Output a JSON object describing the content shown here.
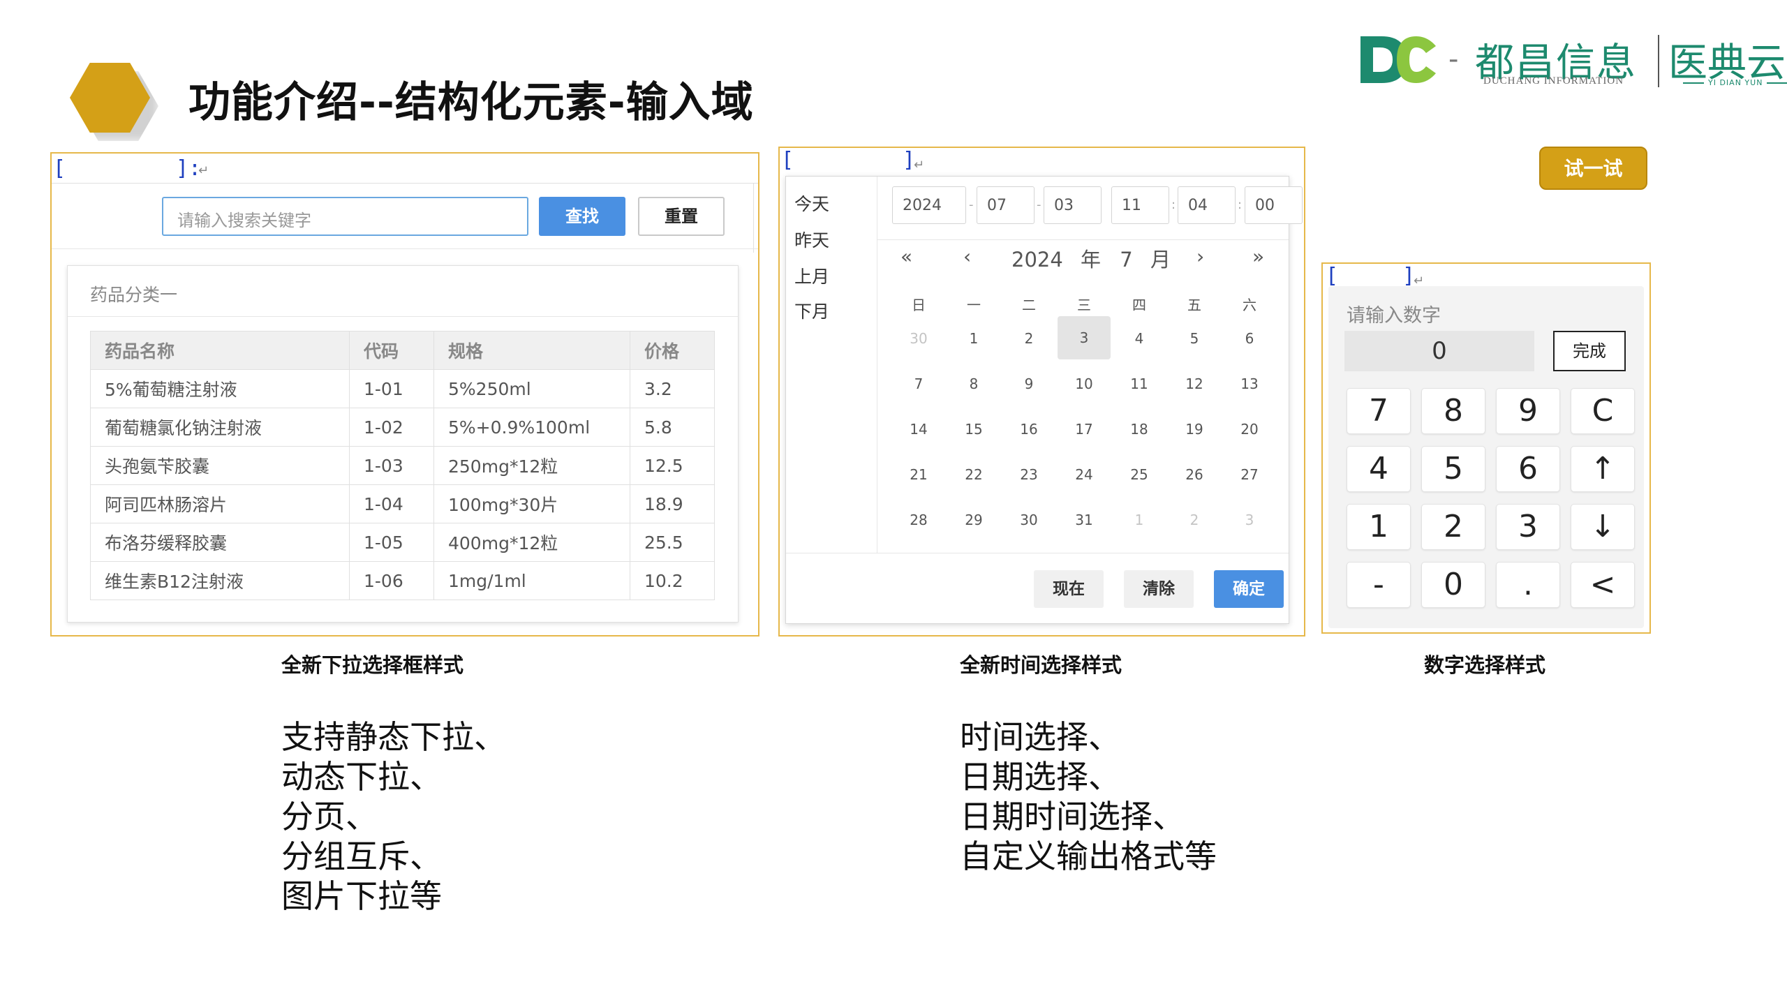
{
  "header": {
    "title": "功能介绍--结构化元素-输入域"
  },
  "logo": {
    "cn": "都昌信息",
    "en": "DUCHANG INFORMATION",
    "cn2": "医典云",
    "en2": "YI DIAN YUN",
    "color": "#1d8a6e"
  },
  "try_button": {
    "label": "试一试",
    "color": "#d4a017"
  },
  "dropdown": {
    "field_open": "[",
    "field_close": "]:",
    "search_placeholder": "请输入搜索关键字",
    "find_label": "查找",
    "reset_label": "重置",
    "category_title": "药品分类一",
    "columns": [
      "药品名称",
      "代码",
      "规格",
      "价格"
    ],
    "rows": [
      [
        "5%葡萄糖注射液",
        "1-01",
        "5%250ml",
        "3.2"
      ],
      [
        "葡萄糖氯化钠注射液",
        "1-02",
        "5%+0.9%100ml",
        "5.8"
      ],
      [
        "头孢氨苄胶囊",
        "1-03",
        "250mg*12粒",
        "12.5"
      ],
      [
        "阿司匹林肠溶片",
        "1-04",
        "100mg*30片",
        "18.9"
      ],
      [
        "布洛芬缓释胶囊",
        "1-05",
        "400mg*12粒",
        "25.5"
      ],
      [
        "维生素B12注射液",
        "1-06",
        "1mg/1ml",
        "10.2"
      ]
    ]
  },
  "datepicker": {
    "field_open": "[",
    "field_close": "]",
    "shortcuts": [
      "今天",
      "昨天",
      "上月",
      "下月"
    ],
    "time_fields": [
      "2024",
      "07",
      "03",
      "11",
      "04",
      "00"
    ],
    "time_separators": [
      "-",
      "-",
      ":",
      ":"
    ],
    "nav": {
      "prev_year": "«",
      "prev_month": "‹",
      "next_month": "›",
      "next_year": "»"
    },
    "year": "2024",
    "year_label": "年",
    "month": "7",
    "month_label": "月",
    "weekdays": [
      "日",
      "一",
      "二",
      "三",
      "四",
      "五",
      "六"
    ],
    "days": [
      [
        {
          "d": "30",
          "m": true
        },
        {
          "d": "1"
        },
        {
          "d": "2"
        },
        {
          "d": "3",
          "s": true
        },
        {
          "d": "4"
        },
        {
          "d": "5"
        },
        {
          "d": "6"
        }
      ],
      [
        {
          "d": "7"
        },
        {
          "d": "8"
        },
        {
          "d": "9"
        },
        {
          "d": "10"
        },
        {
          "d": "11"
        },
        {
          "d": "12"
        },
        {
          "d": "13"
        }
      ],
      [
        {
          "d": "14"
        },
        {
          "d": "15"
        },
        {
          "d": "16"
        },
        {
          "d": "17"
        },
        {
          "d": "18"
        },
        {
          "d": "19"
        },
        {
          "d": "20"
        }
      ],
      [
        {
          "d": "21"
        },
        {
          "d": "22"
        },
        {
          "d": "23"
        },
        {
          "d": "24"
        },
        {
          "d": "25"
        },
        {
          "d": "26"
        },
        {
          "d": "27"
        }
      ],
      [
        {
          "d": "28"
        },
        {
          "d": "29"
        },
        {
          "d": "30"
        },
        {
          "d": "31"
        },
        {
          "d": "1",
          "m": true
        },
        {
          "d": "2",
          "m": true
        },
        {
          "d": "3",
          "m": true
        }
      ]
    ],
    "now_label": "现在",
    "clear_label": "清除",
    "confirm_label": "确定"
  },
  "numpad": {
    "field_open": "[",
    "field_close": "]",
    "placeholder": "请输入数字",
    "value": "0",
    "done_label": "完成",
    "keys": [
      [
        "7",
        "8",
        "9",
        "C"
      ],
      [
        "4",
        "5",
        "6",
        "↑"
      ],
      [
        "1",
        "2",
        "3",
        "↓"
      ],
      [
        "-",
        "0",
        ".",
        "<"
      ]
    ]
  },
  "captions": {
    "dropdown": "全新下拉选择框样式",
    "datepicker": "全新时间选择样式",
    "numpad": "数字选择样式"
  },
  "descriptions": {
    "dropdown": [
      "支持静态下拉、",
      "动态下拉、",
      "分页、",
      "分组互斥、",
      "图片下拉等"
    ],
    "datepicker": [
      "时间选择、",
      "日期选择、",
      "日期时间选择、",
      "自定义输出格式等"
    ]
  }
}
